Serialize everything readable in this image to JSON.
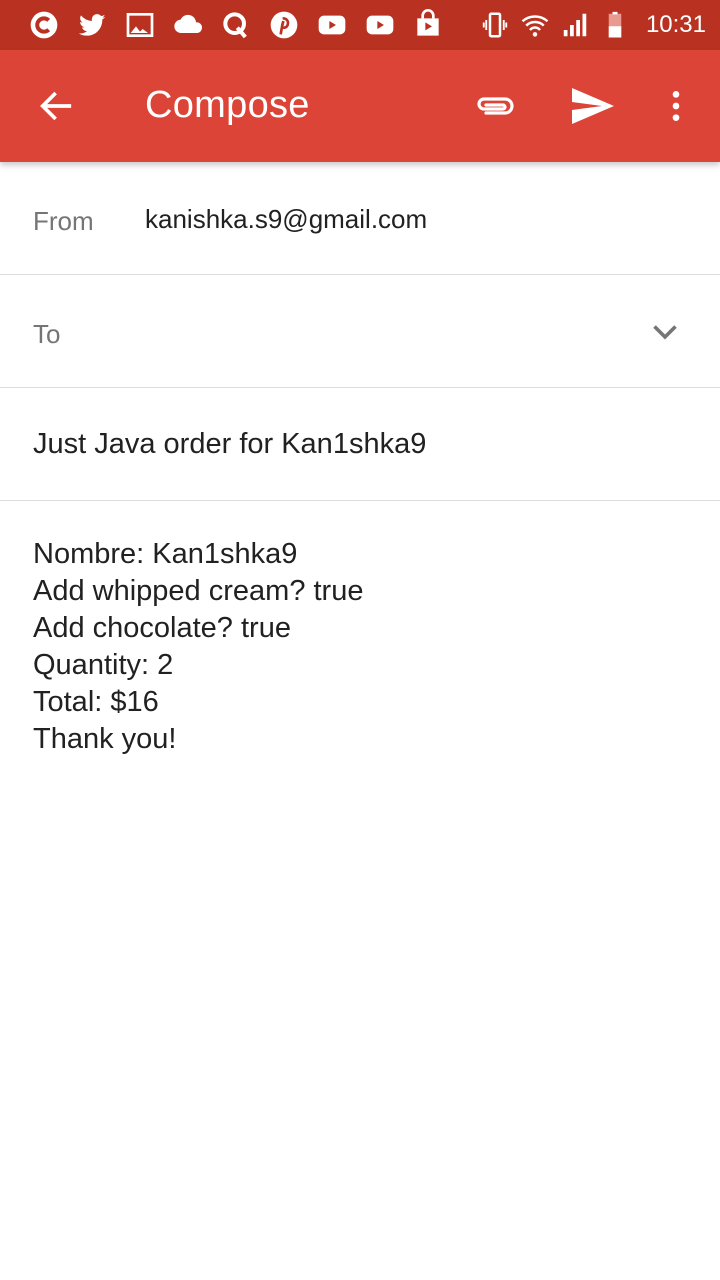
{
  "status_bar": {
    "left_icons": [
      "app-icon",
      "twitter-icon",
      "gallery-icon",
      "cloud-icon",
      "quora-icon",
      "pinterest-icon",
      "youtube-icon",
      "youtube-icon",
      "play-store-icon"
    ],
    "right_icons": [
      "vibrate-icon",
      "wifi-icon",
      "signal-icon",
      "battery-icon"
    ],
    "time": "10:31"
  },
  "app_bar": {
    "title": "Compose",
    "color": "#db4437"
  },
  "compose": {
    "from_label": "From",
    "from_value": "kanishka.s9@gmail.com",
    "to_label": "To",
    "to_value": "",
    "subject": "Just Java order for Kan1shka9",
    "body_lines": [
      "Nombre: Kan1shka9",
      "Add whipped cream? true",
      "Add chocolate? true",
      "Quantity: 2",
      "Total: $16",
      "Thank you!"
    ]
  }
}
